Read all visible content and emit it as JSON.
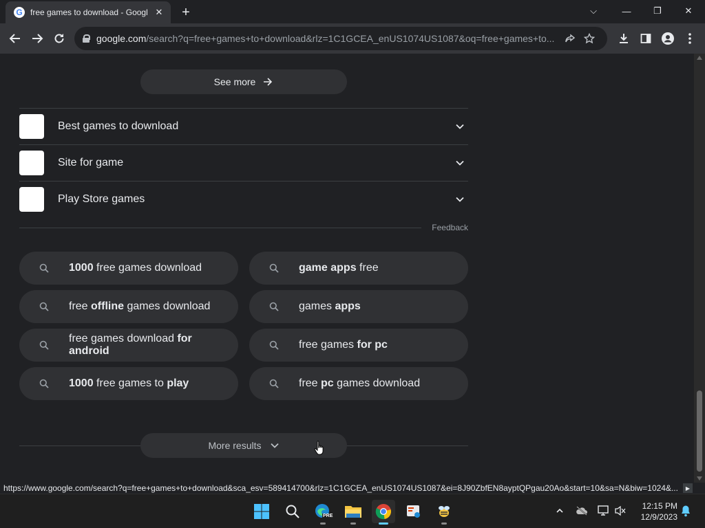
{
  "tab": {
    "title": "free games to download - Googl",
    "favicon_letter": "G",
    "close": "✕"
  },
  "newtab_label": "+",
  "window": {
    "dropdown": "⌵",
    "minimize": "—",
    "restore": "❐",
    "close": "✕"
  },
  "omnibox": {
    "host": "google.com",
    "path": "/search?q=free+games+to+download&rlz=1C1GCEA_enUS1074US1087&oq=free+games+to..."
  },
  "results": {
    "see_more_label": "See more",
    "related": [
      {
        "label": "Best games to download"
      },
      {
        "label": "Site for game"
      },
      {
        "label": "Play Store games"
      }
    ],
    "feedback_label": "Feedback",
    "suggestions": [
      {
        "parts": [
          {
            "t": "1000",
            "b": true
          },
          {
            "t": " free games download",
            "b": false
          }
        ]
      },
      {
        "parts": [
          {
            "t": "game apps",
            "b": true
          },
          {
            "t": " free",
            "b": false
          }
        ]
      },
      {
        "parts": [
          {
            "t": "free ",
            "b": false
          },
          {
            "t": "offline",
            "b": true
          },
          {
            "t": " games download",
            "b": false
          }
        ]
      },
      {
        "parts": [
          {
            "t": "games ",
            "b": false
          },
          {
            "t": "apps",
            "b": true
          }
        ]
      },
      {
        "parts": [
          {
            "t": "free games download ",
            "b": false
          },
          {
            "t": "for android",
            "b": true
          }
        ]
      },
      {
        "parts": [
          {
            "t": "free games ",
            "b": false
          },
          {
            "t": "for pc",
            "b": true
          }
        ]
      },
      {
        "parts": [
          {
            "t": "1000",
            "b": true
          },
          {
            "t": " free games to ",
            "b": false
          },
          {
            "t": "play",
            "b": true
          }
        ]
      },
      {
        "parts": [
          {
            "t": "free ",
            "b": false
          },
          {
            "t": "pc",
            "b": true
          },
          {
            "t": " games download",
            "b": false
          }
        ]
      }
    ],
    "more_results_label": "More results"
  },
  "status_url": "https://www.google.com/search?q=free+games+to+download&sca_esv=589414700&rlz=1C1GCEA_enUS1074US1087&ei=8J90ZbfEN8ayptQPgau20Ao&start=10&sa=N&biw=1024&...",
  "taskbar": {
    "apps": [
      "start-icon",
      "search-icon",
      "edge-preview-icon",
      "file-explorer-icon",
      "chrome-icon",
      "snipping-tool-icon",
      "bee-app-icon"
    ],
    "edge_badge": "PRE",
    "time": "12:15 PM",
    "date": "12/9/2023"
  },
  "colors": {
    "page_bg": "#202124",
    "chip_bg": "#303134",
    "text": "#e8eaed",
    "accent": "#60cdff"
  }
}
